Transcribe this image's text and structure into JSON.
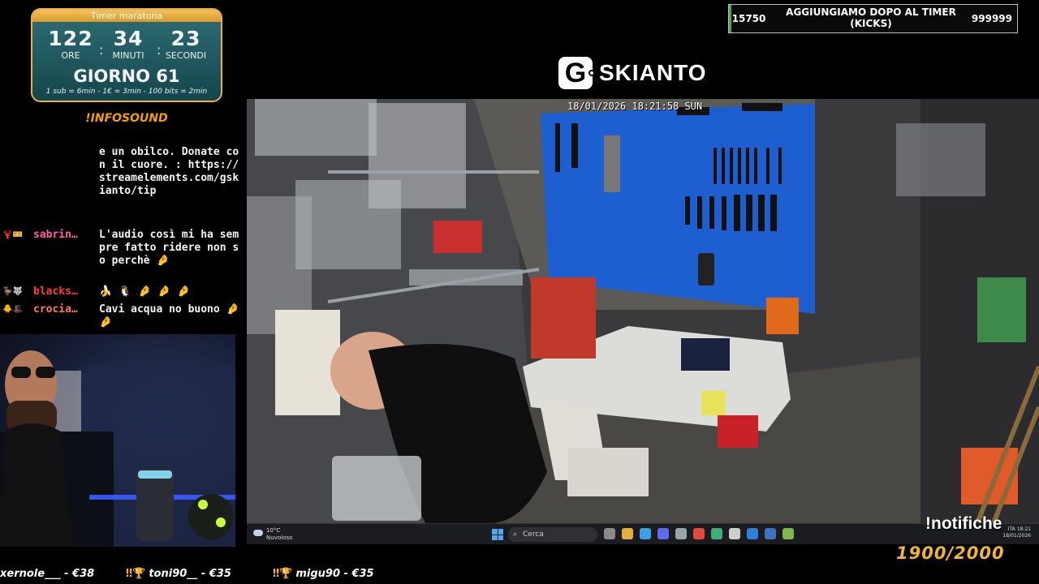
{
  "timer": {
    "title": "Timer maratona",
    "hours": "122",
    "minutes": "34",
    "seconds": "23",
    "hours_label": "ORE",
    "minutes_label": "MINUTI",
    "seconds_label": "SECONDI",
    "separator": ":",
    "day": "GIORNO 61",
    "rates": "1 sub = 6min - 1€ = 3min - 100 bits = 2min"
  },
  "infosound": "!INFOSOUND",
  "chat": {
    "messages": [
      {
        "badges": "",
        "user": "",
        "user_color": "#ffffff",
        "text": "e un obilco. Donate con il cuore. : https://streamelements.com/gskianto/tip"
      },
      {
        "badges": "🦞🎫",
        "user": "sabrin…",
        "user_color": "#ff5fa8",
        "text": "L'audio così mi ha sempre fatto ridere non so perchè 🤌"
      },
      {
        "badges": "🦆🐺",
        "user": "blacks…",
        "user_color": "#ff3b3b",
        "text": "🍌 🐧 🤌 🤌 🤌"
      },
      {
        "badges": "🐥🎩",
        "user": "crocia…",
        "user_color": "#ff7a5a",
        "text": "Cavi acqua no buono 🤌 🤌"
      }
    ]
  },
  "goal": {
    "left_value": "15750",
    "text": "AGGIUNGIAMO DOPO AL TIMER (KICKS)",
    "right_value": "999999"
  },
  "logo": {
    "mark": "G",
    "name": "SKIANTO"
  },
  "camera": {
    "timestamp": "18/01/2026 18:21:58 SUN"
  },
  "taskbar": {
    "weather_temp": "10°C",
    "weather_desc": "Nuvoloso",
    "search_placeholder": "Cerca",
    "search_icon": "search-icon",
    "tray_lang": "ITA",
    "tray_time": "18:21",
    "tray_date": "18/01/2026",
    "app_colors": [
      "#8a8a8a",
      "#e2b13c",
      "#3aa0e8",
      "#5b6cf0",
      "#9aa4ad",
      "#e24b3b",
      "#3fb07a",
      "#cfcfcf",
      "#2f7fd8",
      "#4070c0",
      "#7db84a"
    ]
  },
  "notifiche": "!notifiche",
  "sub_count": "1900/2000",
  "ticker": [
    {
      "icon": "",
      "text": "xernole___ - €38"
    },
    {
      "icon": "‼🏆",
      "text": "toni90__ - €35"
    },
    {
      "icon": "‼🏆",
      "text": "migu90 - €35"
    }
  ],
  "colors": {
    "timer_accent": "#e8b24a",
    "timer_bg": "#1e5a61",
    "infosound": "#f0a000",
    "sub_count": "#f0b436",
    "goal_bar": "#4fa34f",
    "pegboard": "#1d5fd0"
  }
}
